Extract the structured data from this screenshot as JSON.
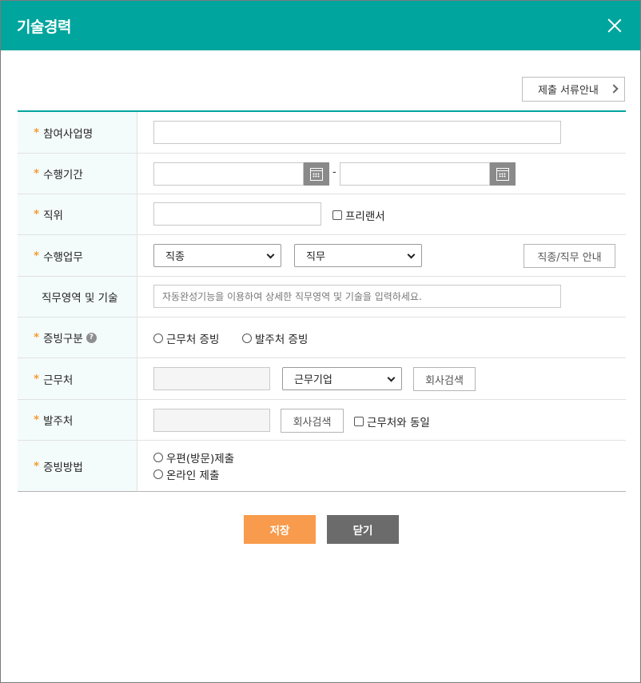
{
  "dialog": {
    "title": "기술경력",
    "guide_button": "제출 서류안내"
  },
  "form": {
    "project_name": {
      "label": "참여사업명",
      "value": ""
    },
    "period": {
      "label": "수행기간",
      "separator": "-"
    },
    "position": {
      "label": "직위",
      "freelancer_label": "프리랜서"
    },
    "duty": {
      "label": "수행업무",
      "job_type": "직종",
      "job_role": "직무",
      "guide_button": "직종/직무 안내"
    },
    "skills": {
      "label": "직무영역 및 기술",
      "placeholder": "자동완성기능을 이용하여 상세한 직무영역 및 기술을 입력하세요."
    },
    "proof_type": {
      "label": "증빙구분",
      "help": "?",
      "option1": "근무처 증빙",
      "option2": "발주처 증빙"
    },
    "workplace": {
      "label": "근무처",
      "company_select": "근무기업",
      "search_button": "회사검색"
    },
    "client": {
      "label": "발주처",
      "search_button": "회사검색",
      "same_label": "근무처와 동일"
    },
    "proof_method": {
      "label": "증빙방법",
      "option1": "우편(방문)제출",
      "option2": "온라인 제출"
    }
  },
  "actions": {
    "save": "저장",
    "close": "닫기"
  },
  "colors": {
    "header": "#00a59d",
    "accent": "#f39c32",
    "save_button": "#f89b4c",
    "close_button": "#6b6b6b"
  }
}
